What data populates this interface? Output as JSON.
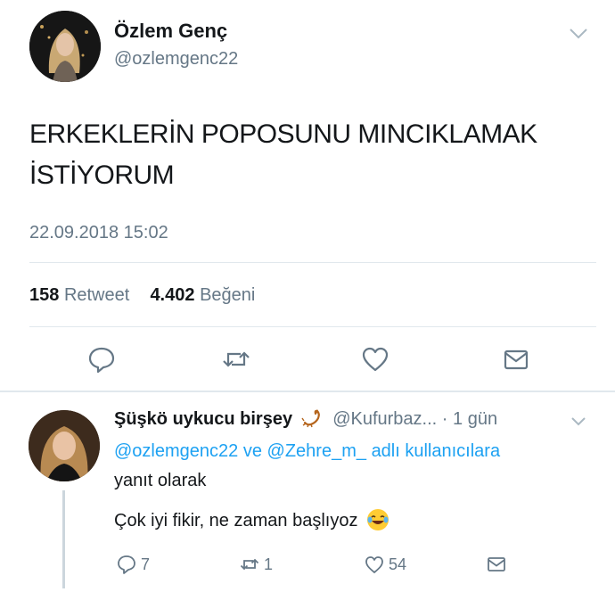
{
  "tweet": {
    "author": {
      "name": "Özlem Genç",
      "handle": "@ozlemgenc22"
    },
    "text_line1": "ERKEKLERİN POPOSUNU MINCIKLAMAK",
    "text_line2": "İSTİYORUM",
    "timestamp": "22.09.2018 15:02",
    "stats": {
      "retweet_count": "158",
      "retweet_label": "Retweet",
      "like_count": "4.402",
      "like_label": "Beğeni"
    },
    "actions": [
      "reply-icon",
      "retweet-icon",
      "like-icon",
      "message-icon"
    ]
  },
  "reply": {
    "author": {
      "name": "Şüşkö uykucu birşey",
      "handle": "@Kufurbaz...",
      "time": "· 1 gün"
    },
    "reply_to": {
      "mention1": "@ozlemgenc22",
      "connector": "ve",
      "mention2": "@Zehre_m_",
      "suffix": "adlı kullanıcılara",
      "line2": "yanıt olarak"
    },
    "text": "Çok iyi fikir, ne zaman başlıyoz",
    "counts": {
      "replies": "7",
      "retweets": "1",
      "likes": "54"
    }
  },
  "colors": {
    "text": "#14171a",
    "muted": "#657786",
    "link": "#1da1f2",
    "divider": "#e1e8ed"
  }
}
